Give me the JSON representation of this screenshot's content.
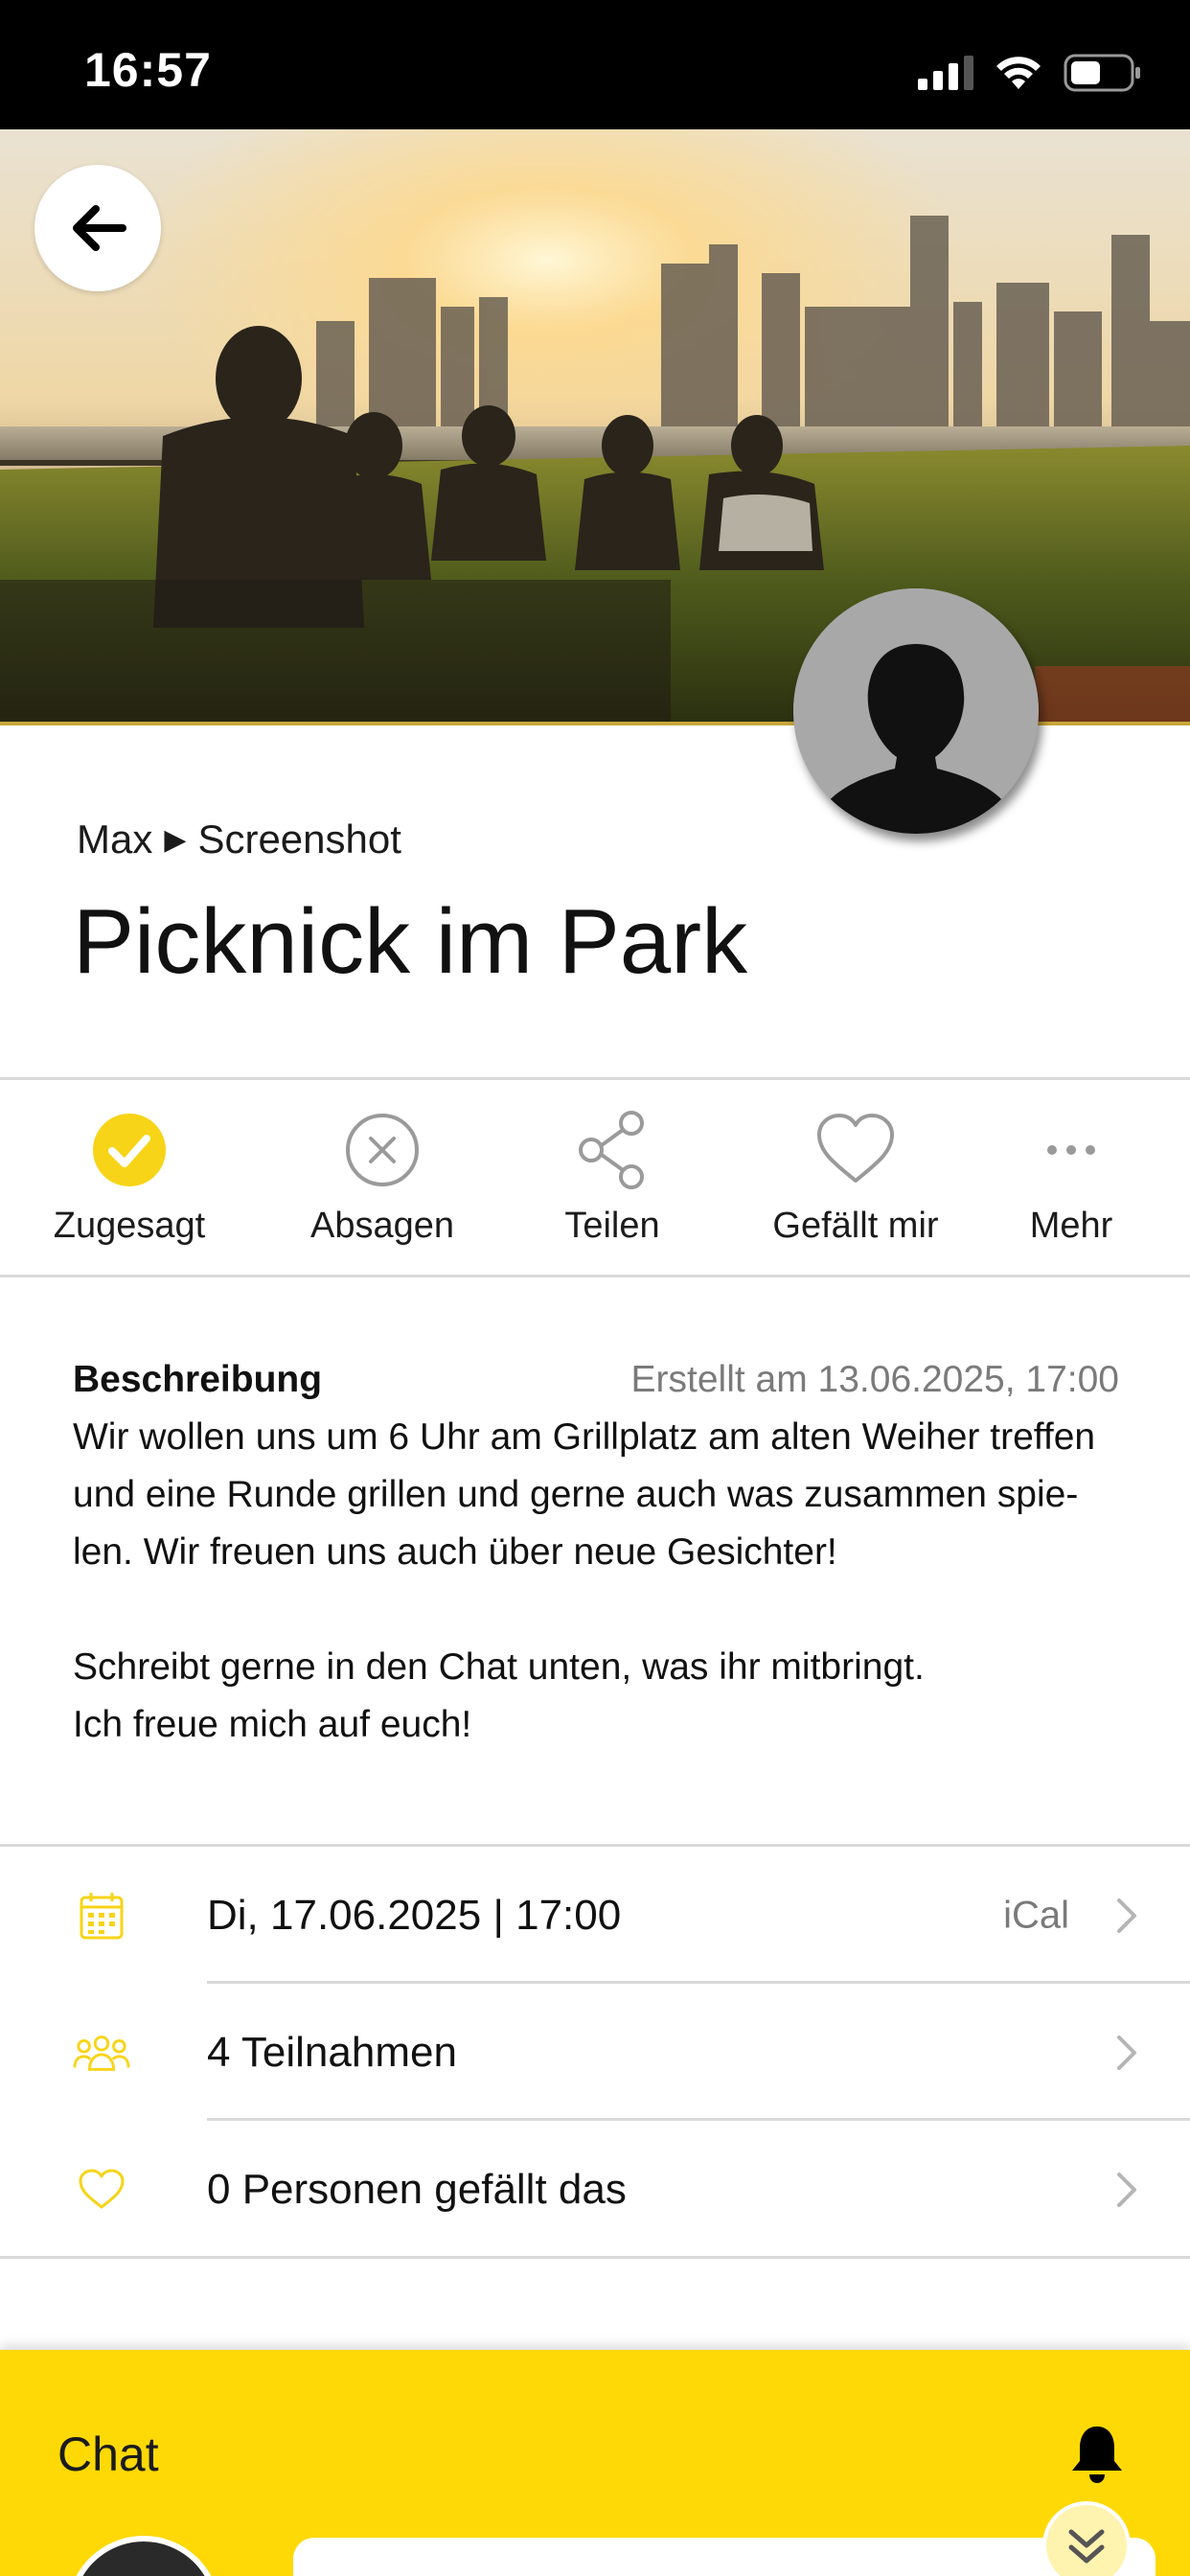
{
  "status_bar": {
    "time": "16:57"
  },
  "colors": {
    "accent": "#ffd905",
    "icon_accent": "#f7d417",
    "muted_text": "#7a7a7a",
    "divider": "#d9d9d9"
  },
  "hero": {
    "image_description_icon": "group-picnic-photo"
  },
  "event": {
    "breadcrumb_user": "Max",
    "breadcrumb_group": "Screenshot",
    "title": "Picknick im Park"
  },
  "actions": [
    {
      "label": "Zugesagt",
      "icon": "check-circle-icon",
      "active": true
    },
    {
      "label": "Absagen",
      "icon": "x-circle-icon",
      "active": false
    },
    {
      "label": "Teilen",
      "icon": "share-icon",
      "active": false
    },
    {
      "label": "Gefällt mir",
      "icon": "heart-icon",
      "active": false
    },
    {
      "label": "Mehr",
      "icon": "more-dots-icon",
      "active": false
    }
  ],
  "description": {
    "heading": "Beschreibung",
    "created": "Erstellt am 13.06.2025, 17:00",
    "line1": "Wir wollen uns um 6 Uhr am Grillplatz am alten Weiher treffen",
    "line2": "und eine Runde grillen und gerne auch was zusammen spie-",
    "line3": "len. Wir freuen uns auch über neue Gesichter!",
    "line4": "Schreibt gerne in den Chat unten, was ihr mitbringt.",
    "line5": "Ich freue mich auf euch!"
  },
  "info_rows": {
    "date": {
      "text": "Di, 17.06.2025 | 17:00",
      "extra": "iCal",
      "icon": "calendar-icon"
    },
    "participants": {
      "text": "4 Teilnahmen",
      "icon": "people-icon"
    },
    "likes": {
      "text": "0 Personen gefällt das",
      "icon": "heart-outline-icon"
    }
  },
  "chat": {
    "title": "Chat",
    "bell_icon": "bell-icon",
    "scroll_icon": "double-chevron-down-icon"
  }
}
